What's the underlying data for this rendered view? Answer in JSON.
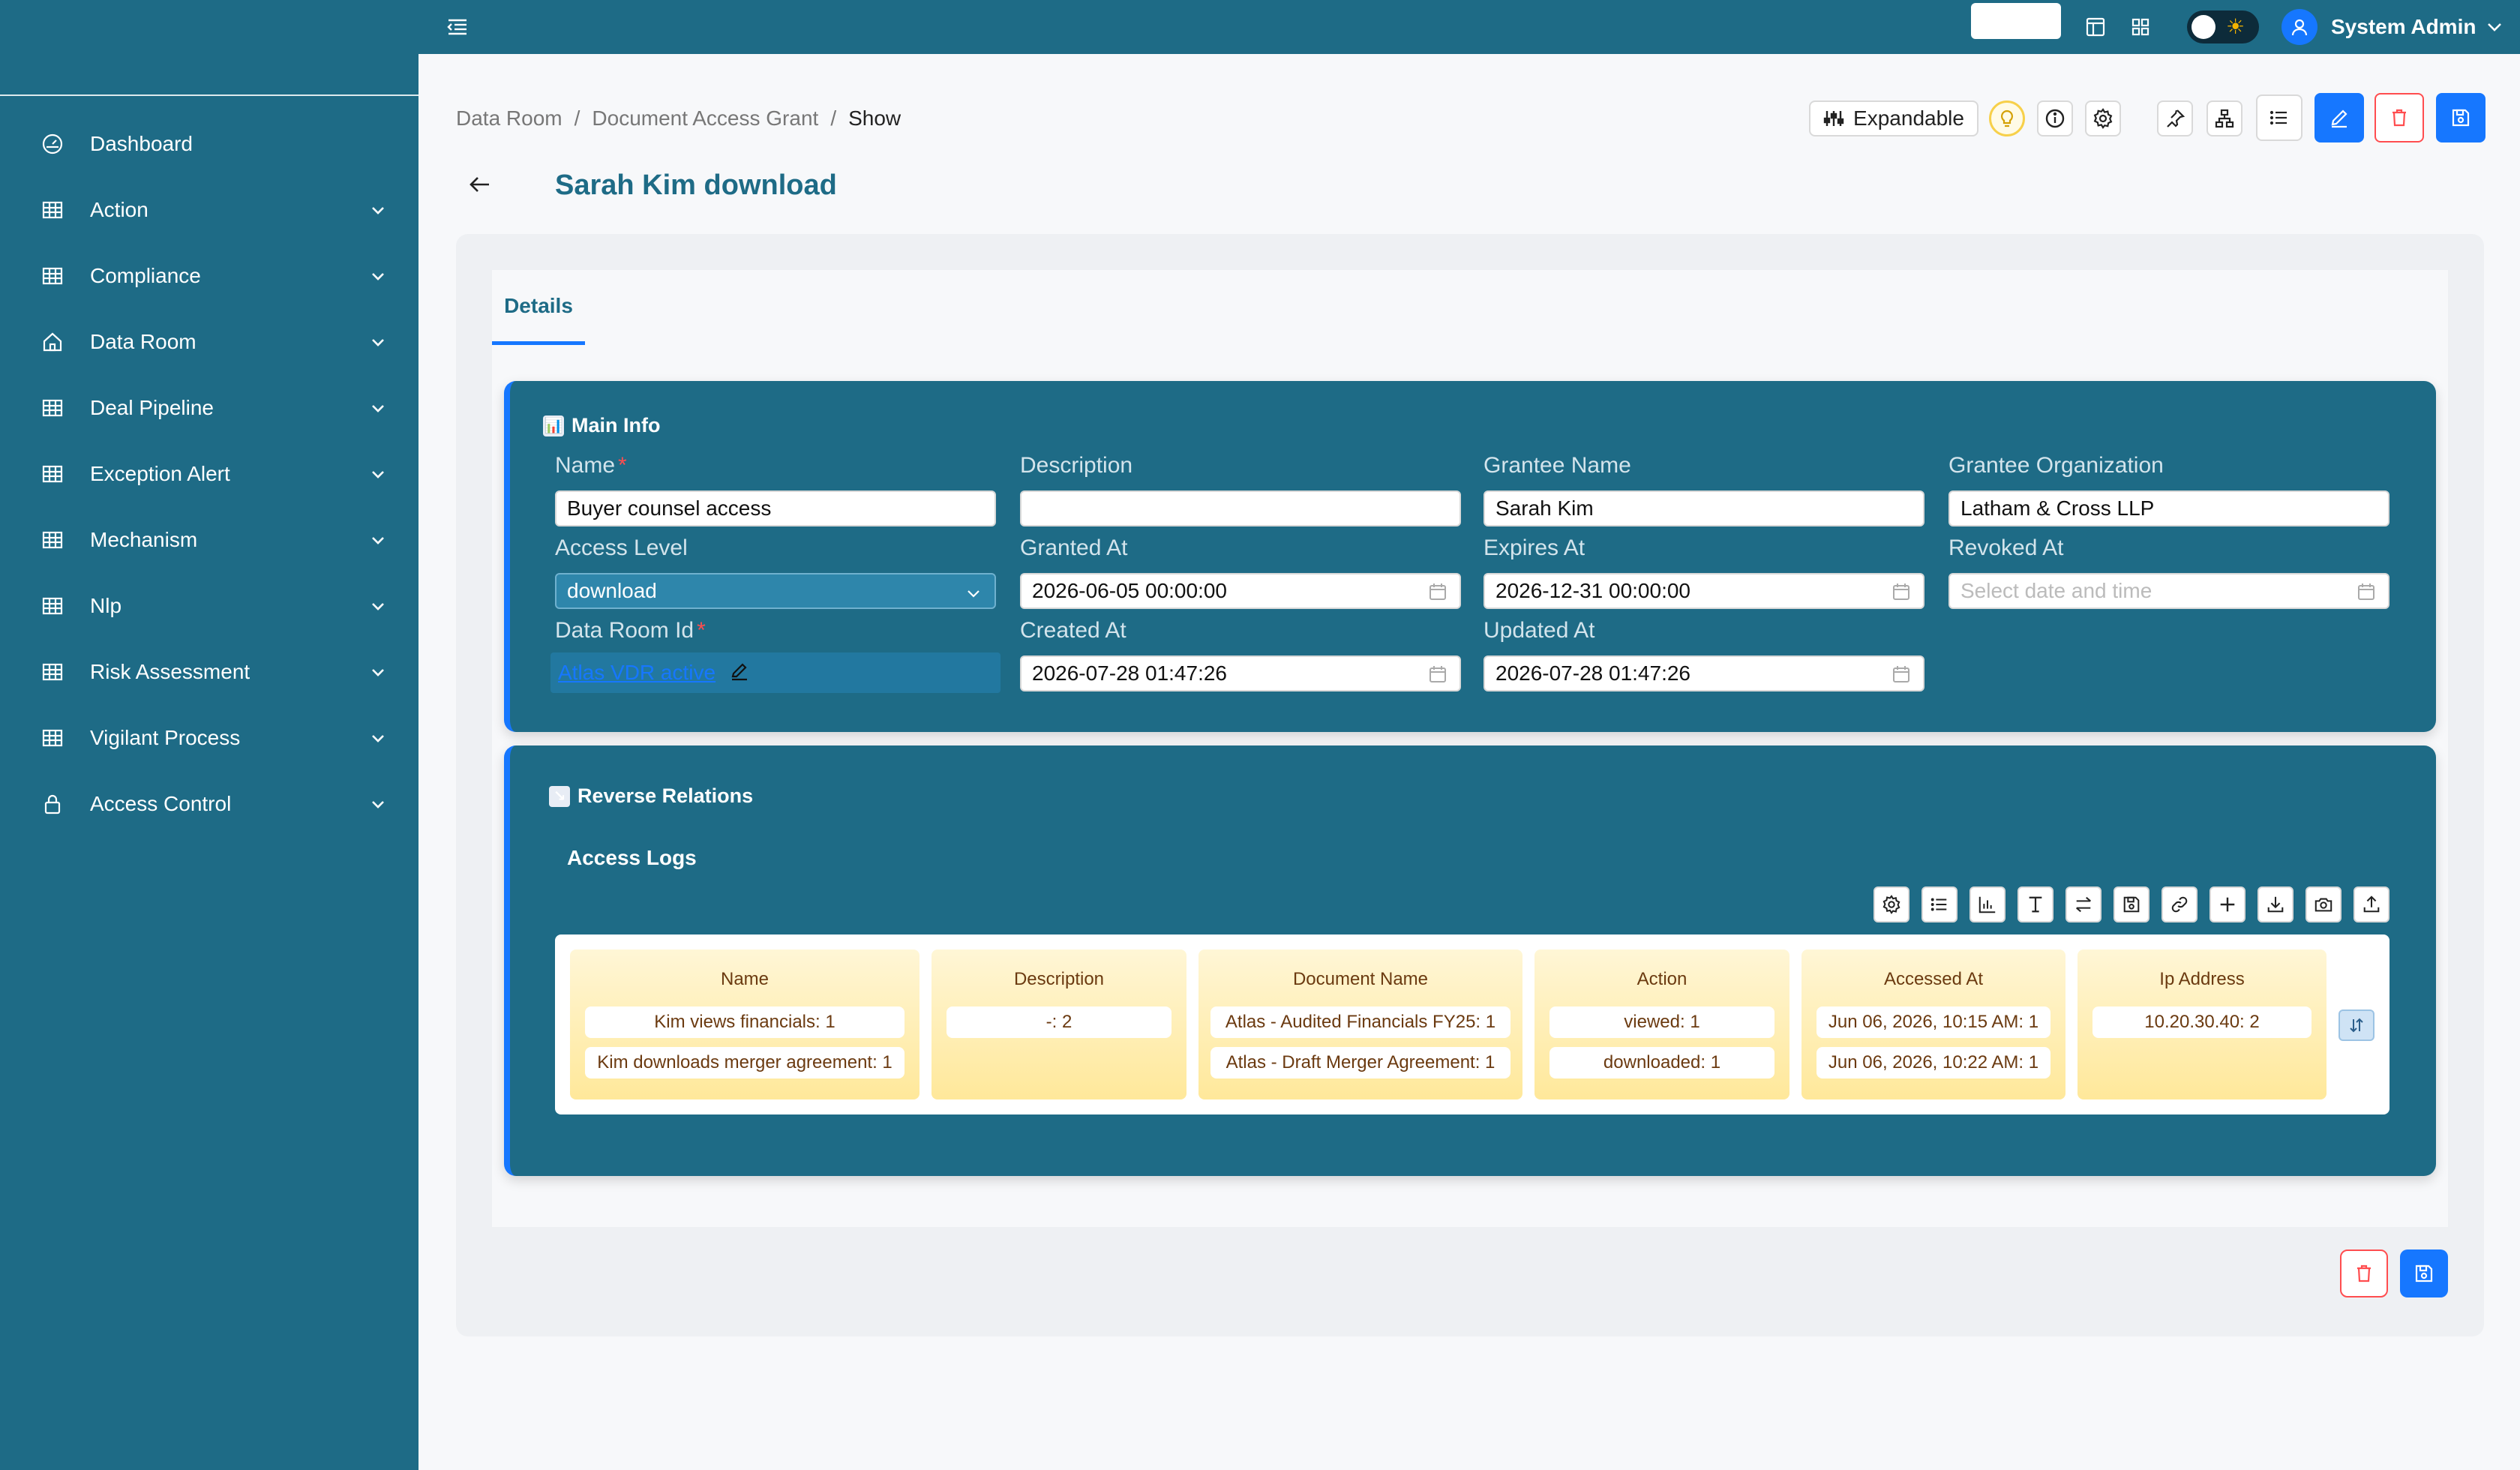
{
  "sidebar": {
    "items": [
      {
        "label": "Dashboard",
        "icon": "dashboard-icon",
        "has_children": false
      },
      {
        "label": "Action",
        "icon": "table-icon",
        "has_children": true
      },
      {
        "label": "Compliance",
        "icon": "table-icon",
        "has_children": true
      },
      {
        "label": "Data Room",
        "icon": "home-icon",
        "has_children": true
      },
      {
        "label": "Deal Pipeline",
        "icon": "table-icon",
        "has_children": true
      },
      {
        "label": "Exception Alert",
        "icon": "table-icon",
        "has_children": true
      },
      {
        "label": "Mechanism",
        "icon": "table-icon",
        "has_children": true
      },
      {
        "label": "Nlp",
        "icon": "table-icon",
        "has_children": true
      },
      {
        "label": "Risk Assessment",
        "icon": "table-icon",
        "has_children": true
      },
      {
        "label": "Vigilant Process",
        "icon": "table-icon",
        "has_children": true
      },
      {
        "label": "Access Control",
        "icon": "lock-icon",
        "has_children": true
      }
    ]
  },
  "topbar": {
    "user_name": "System Admin"
  },
  "breadcrumb": [
    "Data Room",
    "/",
    "Document Access Grant",
    "/",
    "Show"
  ],
  "toolbar": {
    "expandable_label": "Expandable"
  },
  "page": {
    "title": "Sarah Kim download"
  },
  "tabs": [
    {
      "label": "Details",
      "active": true
    }
  ],
  "main_info": {
    "title": "Main Info",
    "fields": {
      "name": {
        "label": "Name",
        "value": "Buyer counsel access",
        "required": true
      },
      "description": {
        "label": "Description",
        "value": ""
      },
      "grantee_name": {
        "label": "Grantee Name",
        "value": "Sarah Kim"
      },
      "grantee_org": {
        "label": "Grantee Organization",
        "value": "Latham & Cross LLP"
      },
      "access_level": {
        "label": "Access Level",
        "value": "download"
      },
      "granted_at": {
        "label": "Granted At",
        "value": "2026-06-05 00:00:00"
      },
      "expires_at": {
        "label": "Expires At",
        "value": "2026-12-31 00:00:00"
      },
      "revoked_at": {
        "label": "Revoked At",
        "placeholder": "Select date and time"
      },
      "data_room_id": {
        "label": "Data Room Id",
        "value": "Atlas VDR active",
        "required": true
      },
      "created_at": {
        "label": "Created At",
        "value": "2026-07-28 01:47:26"
      },
      "updated_at": {
        "label": "Updated At",
        "value": "2026-07-28 01:47:26"
      }
    }
  },
  "reverse_relations": {
    "title": "Reverse Relations",
    "access_logs": {
      "title": "Access Logs",
      "columns": [
        {
          "header": "Name",
          "chips": [
            "Kim views financials: 1",
            "Kim downloads merger agreement: 1"
          ]
        },
        {
          "header": "Description",
          "chips": [
            "-: 2"
          ]
        },
        {
          "header": "Document Name",
          "chips": [
            "Atlas - Audited Financials FY25: 1",
            "Atlas - Draft Merger Agreement: 1"
          ]
        },
        {
          "header": "Action",
          "chips": [
            "viewed: 1",
            "downloaded: 1"
          ]
        },
        {
          "header": "Accessed At",
          "chips": [
            "Jun 06, 2026, 10:15 AM: 1",
            "Jun 06, 2026, 10:22 AM: 1"
          ]
        },
        {
          "header": "Ip Address",
          "chips": [
            "10.20.30.40: 2"
          ]
        }
      ]
    }
  },
  "colors": {
    "sidebar": "#1e6b86",
    "primary": "#1677ff",
    "danger": "#ff4d4f",
    "column_gradient_top": "#fff6d6",
    "column_gradient_bottom": "#ffe89a"
  }
}
